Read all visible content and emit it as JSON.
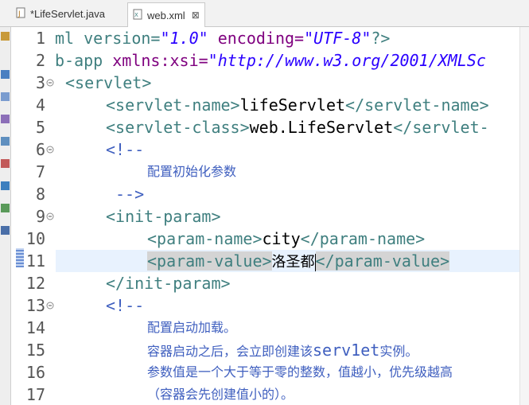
{
  "tabs": [
    {
      "label": "*LifeServlet.java",
      "active": false
    },
    {
      "label": "web.xml",
      "active": true
    }
  ],
  "tab_close_glyph": "⊠",
  "lines": {
    "l1": {
      "num": "1",
      "a": "ml version=",
      "b": "\"1.0\"",
      "c": " encoding=",
      "d": "\"UTF-8\"",
      "e": "?>"
    },
    "l2": {
      "num": "2",
      "a": "b-app ",
      "b": "xmlns:xsi=",
      "c": "\"http://www.w3.org/2001/XMLSc"
    },
    "l3": {
      "num": "3",
      "a": "<servlet>"
    },
    "l4": {
      "num": "4",
      "open": "<servlet-name>",
      "text": "lifeServlet",
      "close": "</servlet-name>"
    },
    "l5": {
      "num": "5",
      "open": "<servlet-class>",
      "text": "web.LifeServlet",
      "close": "</servlet-"
    },
    "l6": {
      "num": "6",
      "a": "<!--"
    },
    "l7": {
      "num": "7",
      "a": "配置初始化参数"
    },
    "l8": {
      "num": "8",
      "a": "-->"
    },
    "l9": {
      "num": "9",
      "a": "<init-param>"
    },
    "l10": {
      "num": "10",
      "open": "<param-name>",
      "text": "city",
      "close": "</param-name>"
    },
    "l11": {
      "num": "11",
      "open": "<param-value>",
      "text": "洛圣都",
      "close": "</param-value>"
    },
    "l12": {
      "num": "12",
      "a": "</init-param>"
    },
    "l13": {
      "num": "13",
      "a": "<!--"
    },
    "l14": {
      "num": "14",
      "a": "配置启动加载。"
    },
    "l15": {
      "num": "15",
      "a": "容器启动之后，会立即创建该",
      "b": "serv1et",
      "c": "实例。"
    },
    "l16": {
      "num": "16",
      "a": "参数值是一个大于等于零的整数，值越小，优先级越高"
    },
    "l17": {
      "num": "17",
      "a": "（容器会先创建值小的）。"
    }
  },
  "colors": {
    "tag": "#3f7f7f",
    "attribute": "#7f007f",
    "value": "#2a00ff",
    "comment": "#3f5fbf",
    "current_line": "#e8f2fe"
  }
}
